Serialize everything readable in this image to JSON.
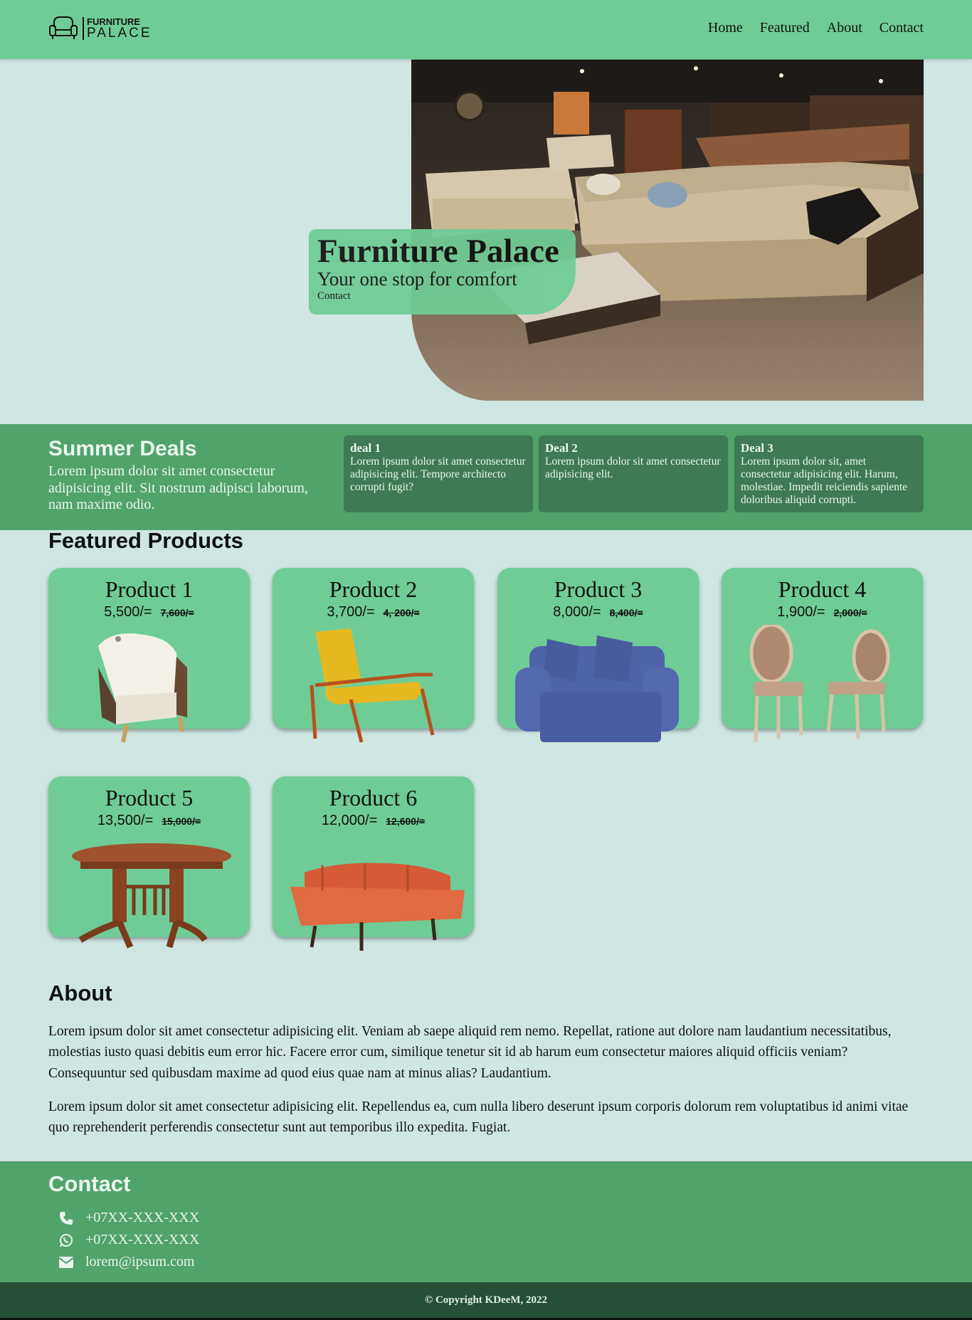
{
  "brand": {
    "line1": "FURNITURE",
    "line2": "PALACE"
  },
  "nav": [
    "Home",
    "Featured",
    "About",
    "Contact"
  ],
  "hero": {
    "title": "Furniture Palace",
    "subtitle": "Your one stop for comfort",
    "link": "Contact"
  },
  "deals": {
    "title": "Summer Deals",
    "description": "Lorem ipsum dolor sit amet consectetur adipisicing elit. Sit nostrum adipisci laborum, nam maxime odio.",
    "items": [
      {
        "title": "deal 1",
        "text": "Lorem ipsum dolor sit amet consectetur adipisicing elit. Tempore architecto corrupti fugit?"
      },
      {
        "title": "Deal 2",
        "text": "Lorem ipsum dolor sit amet consectetur adipisicing elit."
      },
      {
        "title": "Deal 3",
        "text": "Lorem ipsum dolor sit, amet consectetur adipisicing elit. Harum, molestiae. Impedit reiciendis sapiente doloribus aliquid corrupti."
      }
    ]
  },
  "featured": {
    "title": "Featured Products",
    "products": [
      {
        "name": "Product 1",
        "price": "5,500/=",
        "old_price": "7,600/=",
        "image": "white-armchair"
      },
      {
        "name": "Product 2",
        "price": "3,700/=",
        "old_price": "4, 200/=",
        "image": "yellow-lounge-chair"
      },
      {
        "name": "Product 3",
        "price": "8,000/=",
        "old_price": "8,400/=",
        "image": "blue-loveseat"
      },
      {
        "name": "Product 4",
        "price": "1,900/=",
        "old_price": "2,000/=",
        "image": "pair-of-chairs"
      },
      {
        "name": "Product 5",
        "price": "13,500/=",
        "old_price": "15,000/=",
        "image": "wooden-table"
      },
      {
        "name": "Product 6",
        "price": "12,000/=",
        "old_price": "12,600/=",
        "image": "orange-sofa"
      }
    ]
  },
  "about": {
    "title": "About",
    "paragraphs": [
      "Lorem ipsum dolor sit amet consectetur adipisicing elit. Veniam ab saepe aliquid rem nemo. Repellat, ratione aut dolore nam laudantium necessitatibus, molestias iusto quasi debitis eum error hic. Facere error cum, similique tenetur sit id ab harum eum consectetur maiores aliquid officiis veniam? Consequuntur sed quibusdam maxime ad quod eius quae nam at minus alias? Laudantium.",
      "Lorem ipsum dolor sit amet consectetur adipisicing elit. Repellendus ea, cum nulla libero deserunt ipsum corporis dolorum rem voluptatibus id animi vitae quo reprehenderit perferendis consectetur sunt aut temporibus illo expedita. Fugiat."
    ]
  },
  "contact": {
    "title": "Contact",
    "items": [
      {
        "icon": "phone-icon",
        "text": "+07XX-XXX-XXX"
      },
      {
        "icon": "whatsapp-icon",
        "text": "+07XX-XXX-XXX"
      },
      {
        "icon": "envelope-icon",
        "text": "lorem@ipsum.com"
      }
    ]
  },
  "footer": {
    "copyright": "© Copyright KDeeM, 2022"
  },
  "colors": {
    "nav": "#6fcc96",
    "background": "#cfe6e3",
    "deals": "#51a36c",
    "deal_card": "#3d7a55",
    "footer": "#264f37"
  }
}
